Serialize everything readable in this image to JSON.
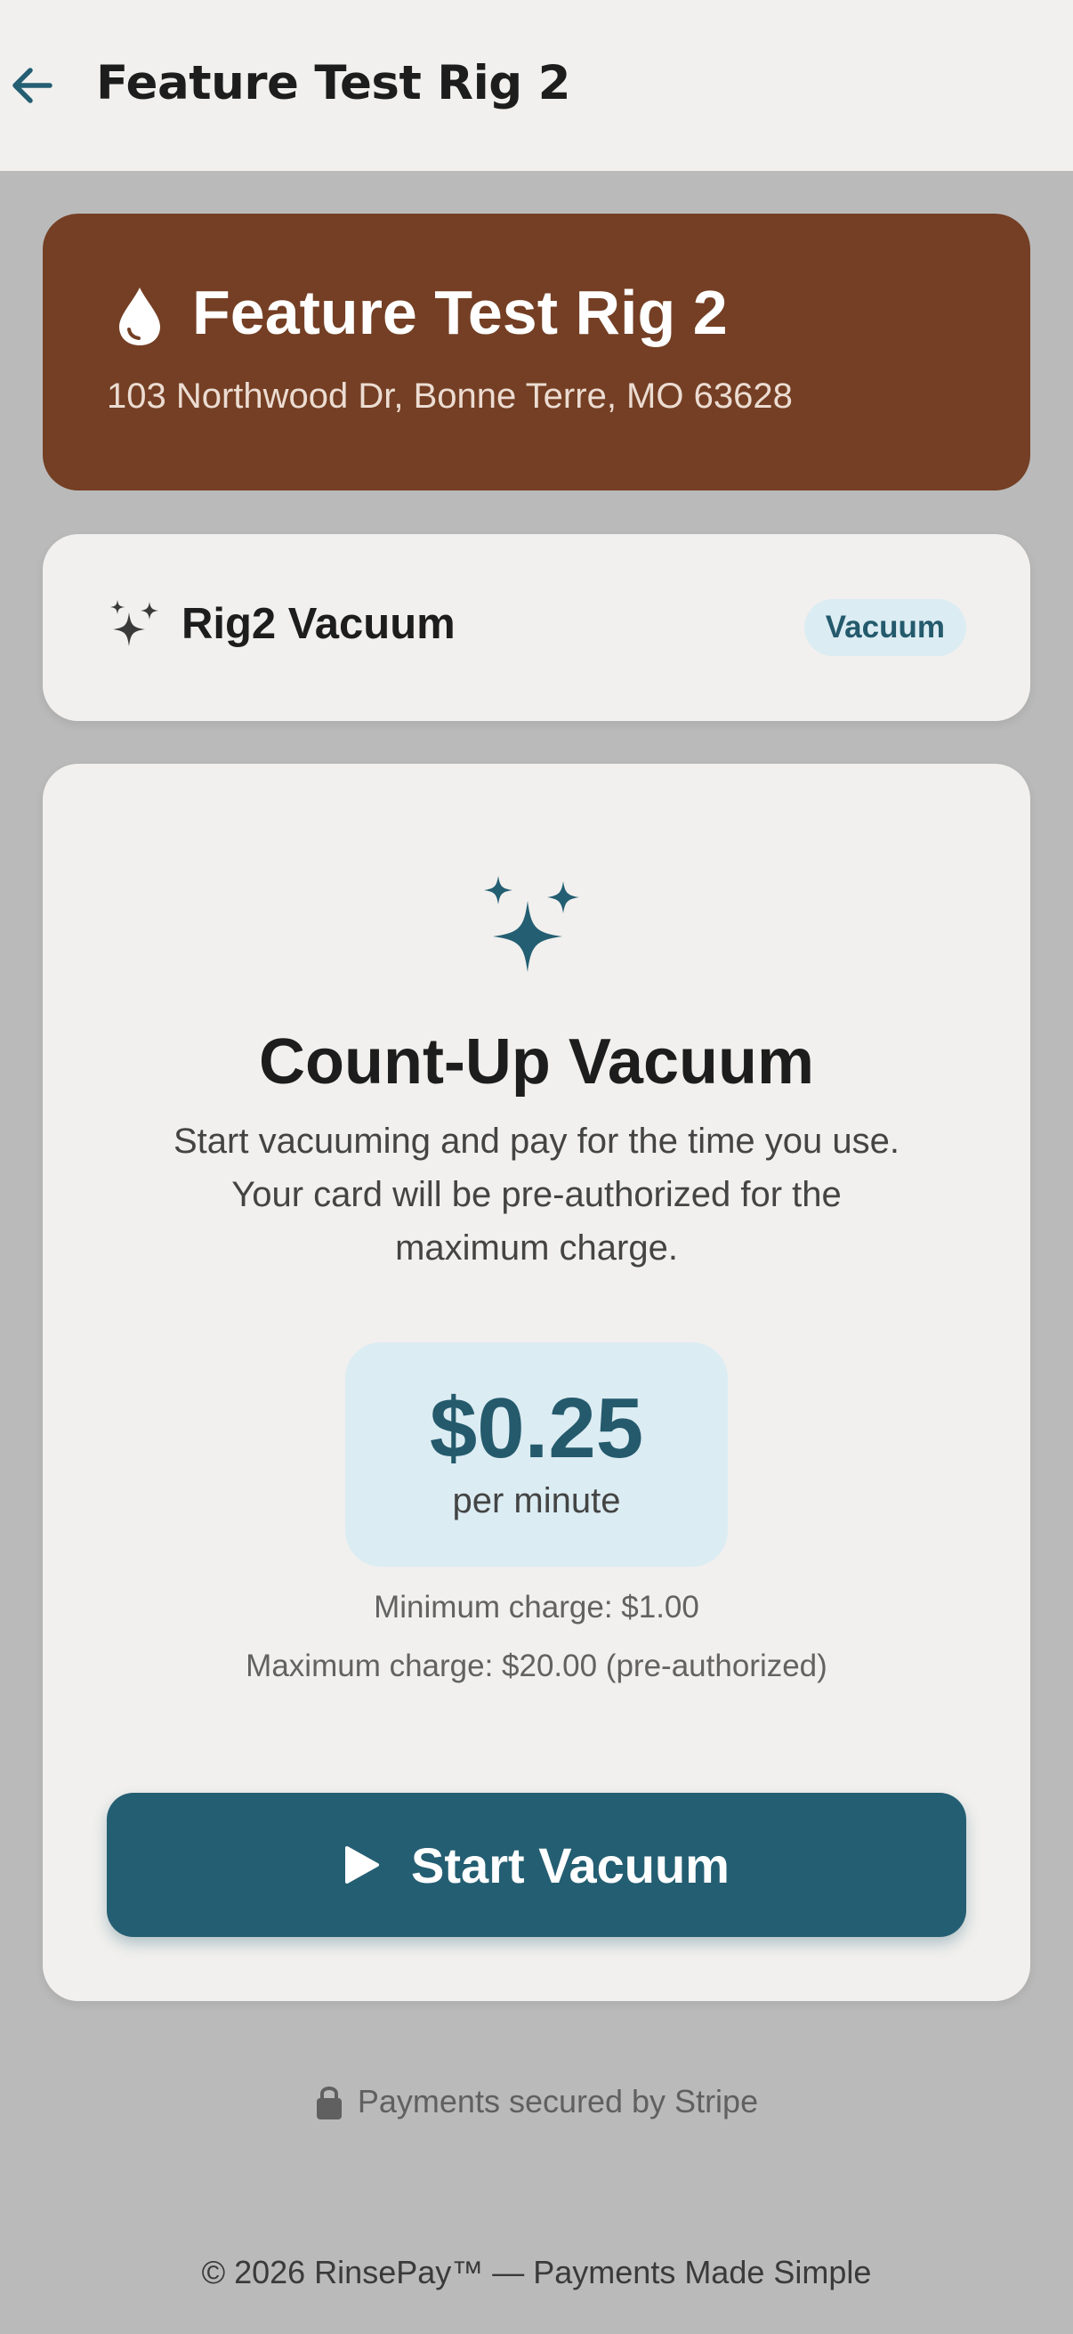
{
  "appbar": {
    "title": "Feature Test Rig 2",
    "back_icon": "arrow-left-icon"
  },
  "location": {
    "name": "Feature Test Rig 2",
    "address": "103 Northwood Dr, Bonne Terre, MO 63628",
    "icon": "water-drop-icon",
    "color": "#743f24"
  },
  "service": {
    "name": "Rig2 Vacuum",
    "badge": "Vacuum",
    "icon": "sparkles-icon"
  },
  "vacuum": {
    "icon": "sparkles-icon",
    "title": "Count-Up Vacuum",
    "description": "Start vacuuming and pay for the time you use. Your card will be pre-authorized for the maximum charge.",
    "price": "$0.25",
    "price_unit": "per minute",
    "min_charge": "Minimum charge: $1.00",
    "max_charge": "Maximum charge: $20.00 (pre-authorized)",
    "start_label": "Start Vacuum",
    "accent": "#245e72"
  },
  "security": {
    "text": "Payments secured by Stripe",
    "icon": "lock-icon"
  },
  "footer": {
    "text": "© 2026 RinsePay™ — Payments Made Simple"
  }
}
